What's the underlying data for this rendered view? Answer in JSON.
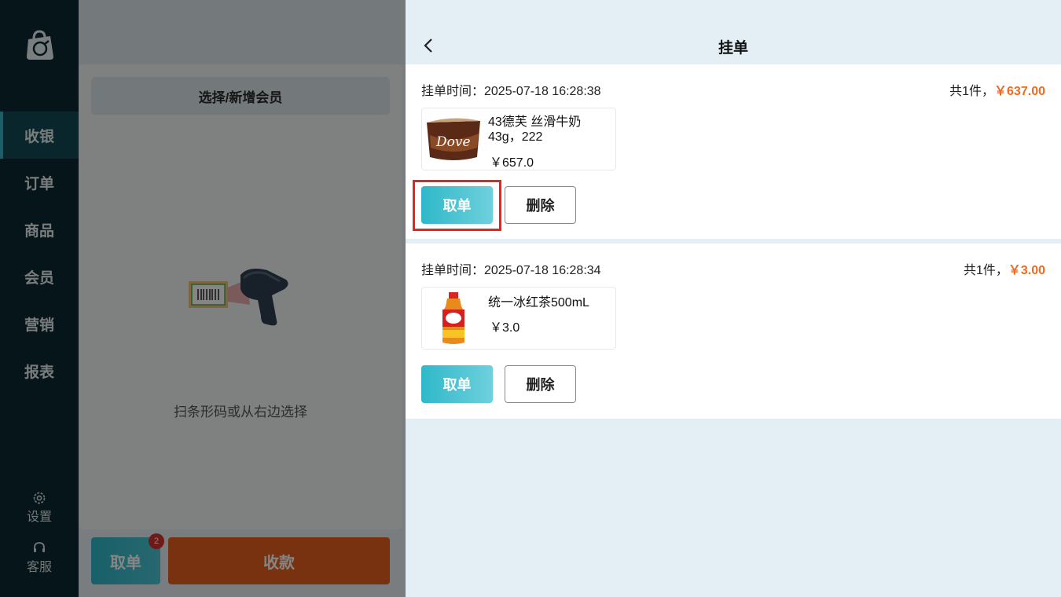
{
  "sidebar": {
    "logo_icon": "shopping-bag-icon",
    "items": [
      {
        "label": "收银",
        "active": true
      },
      {
        "label": "订单",
        "active": false
      },
      {
        "label": "商品",
        "active": false
      },
      {
        "label": "会员",
        "active": false
      },
      {
        "label": "营销",
        "active": false
      },
      {
        "label": "报表",
        "active": false
      }
    ],
    "settings_label": "设置",
    "service_label": "客服"
  },
  "cashier": {
    "member_button": "选择/新增会员",
    "scan_hint": "扫条形码或从右边选择",
    "pickup_button": "取单",
    "pickup_badge": "2",
    "pay_button": "收款"
  },
  "drawer": {
    "title": "挂单",
    "orders": [
      {
        "time_label": "挂单时间：2025-07-18 16:28:38",
        "count_label": "共1件，",
        "total": "￥637.00",
        "product_name": "43德芙 丝滑牛奶43g，222",
        "product_price": "￥657.0",
        "take_label": "取单",
        "delete_label": "删除"
      },
      {
        "time_label": "挂单时间：2025-07-18 16:28:34",
        "count_label": "共1件，",
        "total": "￥3.00",
        "product_name": "统一冰红茶500mL",
        "product_price": "￥3.0",
        "take_label": "取单",
        "delete_label": "删除"
      }
    ]
  },
  "colors": {
    "sidebar_bg": "#0d2a33",
    "accent": "#36b7c8",
    "price": "#ee6a1f",
    "pay": "#e9601e",
    "highlight": "#e8231d"
  }
}
